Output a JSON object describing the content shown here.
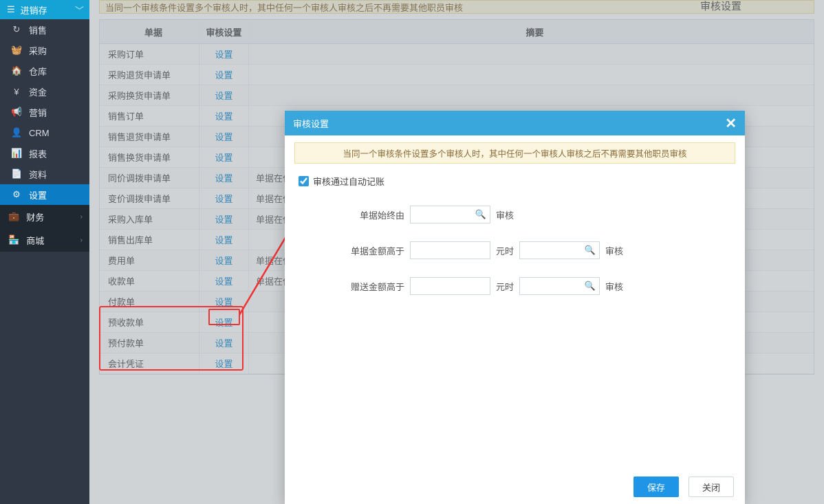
{
  "sidebar": {
    "header": "进销存",
    "items": [
      {
        "icon": "↻",
        "label": "销售"
      },
      {
        "icon": "🧺",
        "label": "采购"
      },
      {
        "icon": "🏠",
        "label": "仓库"
      },
      {
        "icon": "¥",
        "label": "资金"
      },
      {
        "icon": "📢",
        "label": "营销"
      },
      {
        "icon": "👤",
        "label": "CRM"
      },
      {
        "icon": "📊",
        "label": "报表"
      },
      {
        "icon": "📄",
        "label": "资料"
      },
      {
        "icon": "⚙",
        "label": "设置"
      }
    ],
    "sections": [
      {
        "icon": "💼",
        "label": "财务"
      },
      {
        "icon": "🏪",
        "label": "商城"
      }
    ]
  },
  "top_notice": "当同一个审核条件设置多个审核人时，其中任何一个审核人审核之后不再需要其他职员审核",
  "page_title": "审核设置",
  "table": {
    "headers": {
      "c1": "单据",
      "c2": "审核设置",
      "c3": "摘要"
    },
    "link": "设置",
    "rows": [
      {
        "name": "采购订单",
        "note": ""
      },
      {
        "name": "采购退货申请单",
        "note": ""
      },
      {
        "name": "采购换货申请单",
        "note": ""
      },
      {
        "name": "销售订单",
        "note": ""
      },
      {
        "name": "销售退货申请单",
        "note": ""
      },
      {
        "name": "销售换货申请单",
        "note": ""
      },
      {
        "name": "同价调拨申请单",
        "note": "单据在任"
      },
      {
        "name": "变价调拨申请单",
        "note": "单据在任"
      },
      {
        "name": "采购入库单",
        "note": "单据在任"
      },
      {
        "name": "销售出库单",
        "note": ""
      },
      {
        "name": "费用单",
        "note": "单据在任"
      },
      {
        "name": "收款单",
        "note": "单据在任"
      },
      {
        "name": "付款单",
        "note": ""
      },
      {
        "name": "预收款单",
        "note": ""
      },
      {
        "name": "预付款单",
        "note": ""
      },
      {
        "name": "会计凭证",
        "note": ""
      }
    ]
  },
  "modal": {
    "title": "审核设置",
    "notice": "当同一个审核条件设置多个审核人时，其中任何一个审核人审核之后不再需要其他职员审核",
    "checkbox_label": "审核通过自动记账",
    "row1": {
      "label": "单据始终由",
      "suffix": "审核"
    },
    "row2": {
      "label": "单据金额高于",
      "mid": "元时",
      "suffix": "审核"
    },
    "row3": {
      "label": "赠送金额高于",
      "mid": "元时",
      "suffix": "审核"
    },
    "save": "保存",
    "close": "关闭"
  }
}
